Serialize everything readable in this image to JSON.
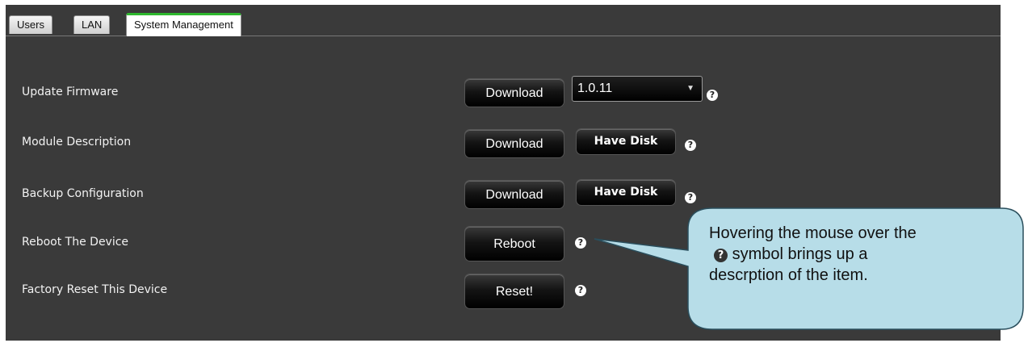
{
  "tabs": [
    {
      "label": "Users",
      "active": false
    },
    {
      "label": "LAN",
      "active": false
    },
    {
      "label": "System Management",
      "active": true
    }
  ],
  "rows": {
    "update_firmware": {
      "label": "Update Firmware",
      "download_label": "Download",
      "version_select_value": "1.0.11",
      "help": "?"
    },
    "module_description": {
      "label": "Module Description",
      "download_label": "Download",
      "have_disk_label": "Have Disk",
      "help": "?"
    },
    "backup_configuration": {
      "label": "Backup Configuration",
      "download_label": "Download",
      "have_disk_label": "Have Disk",
      "help": "?"
    },
    "reboot": {
      "label": "Reboot The Device",
      "button_label": "Reboot",
      "help": "?"
    },
    "factory_reset": {
      "label": "Factory Reset This Device",
      "button_label": "Reset!",
      "help": "?"
    }
  },
  "callout": {
    "line1": "Hovering the mouse over the",
    "icon": "?",
    "line2": "symbol brings up a",
    "line3": "descrption of the item."
  },
  "colors": {
    "panel_bg": "#3a3a3a",
    "active_tab_accent": "#2eb82e",
    "callout_fill": "#b7dde8",
    "callout_stroke": "#2a4e5c"
  }
}
